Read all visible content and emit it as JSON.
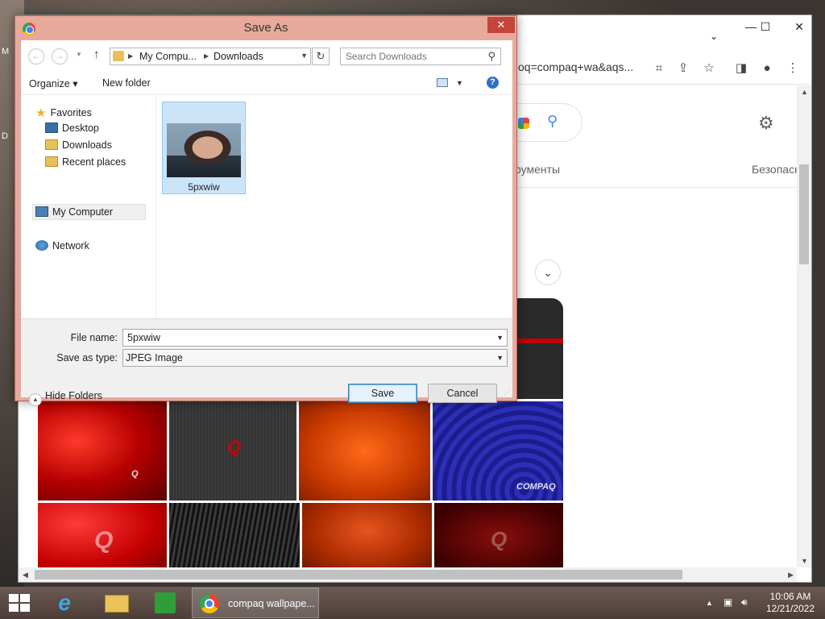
{
  "desktop": {
    "labels": [
      "M",
      "D"
    ]
  },
  "browser": {
    "omnibox_text": "oq=compaq+wa&aqs...",
    "controls": {
      "minimize": "—",
      "maximize": "☐",
      "close": "✕",
      "tab_list": "⌄"
    },
    "search_nav": {
      "tools": "рументы",
      "safe_search": "Безопасн"
    }
  },
  "dialog": {
    "title": "Save As",
    "close": "✕",
    "address": {
      "crumbs": [
        "My Compu...",
        "Downloads"
      ]
    },
    "search": {
      "placeholder": "Search Downloads"
    },
    "toolbar": {
      "organize": "Organize",
      "new_folder": "New folder",
      "help": "?"
    },
    "nav": {
      "favorites": "Favorites",
      "desktop": "Desktop",
      "downloads": "Downloads",
      "recent_places": "Recent places",
      "my_computer": "My Computer",
      "network": "Network"
    },
    "files": [
      {
        "name": "5pxwiw"
      }
    ],
    "file_name_label": "File name:",
    "file_name_value": "5pxwiw",
    "save_as_type_label": "Save as type:",
    "save_as_type_value": "JPEG Image",
    "hide_folders": "Hide Folders",
    "save_button": "Save",
    "cancel_button": "Cancel"
  },
  "taskbar": {
    "chrome_task_label": "compaq wallpape...",
    "clock_time": "10:06 AM",
    "clock_date": "12/21/2022"
  },
  "image_logos": [
    "COMPAQ",
    "Q"
  ],
  "colors": {
    "dialog_frame": "#e8a99d",
    "close_red": "#c7443a",
    "selection": "#cce4f7",
    "taskbar": "#5b4a44"
  }
}
